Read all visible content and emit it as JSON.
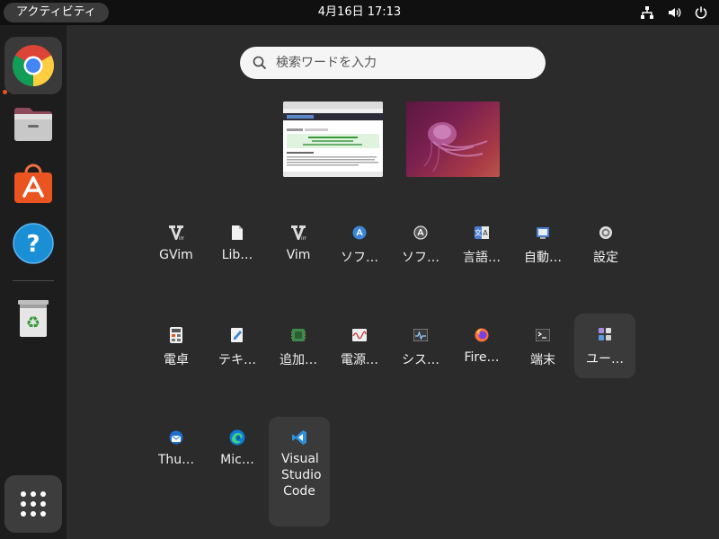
{
  "topbar": {
    "activities_label": "アクティビティ",
    "clock": "4月16日  17:13"
  },
  "dock": {
    "items": [
      "chrome-icon",
      "files-icon",
      "software-store-icon",
      "help-icon",
      "trash-icon"
    ],
    "show_apps_icon": "grid-icon"
  },
  "search": {
    "placeholder": "検索ワードを入力"
  },
  "apps": {
    "row1": [
      "GVim",
      "Lib…",
      "Vim",
      "ソフ…",
      "ソフ…",
      "言語…",
      "自動…",
      "設定"
    ],
    "row2": [
      "電卓",
      "テキ…",
      "追加…",
      "電源…",
      "シス…",
      "Fire…",
      "端末",
      "ユー…"
    ],
    "row3": [
      "Thu…",
      "Mic…",
      "Visual Studio Code"
    ]
  },
  "colors": {
    "accent": "#e95420",
    "vscode": "#2f8fd8",
    "firefox": "#ff7139"
  }
}
